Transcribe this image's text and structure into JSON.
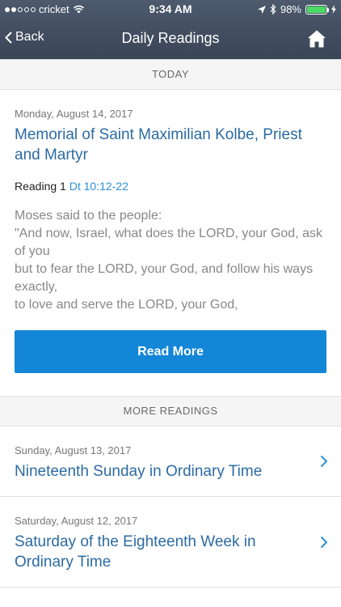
{
  "status_bar": {
    "carrier": "cricket",
    "time": "9:34 AM",
    "battery_percent": "98%",
    "battery_level": 0.98
  },
  "nav": {
    "back_label": "Back",
    "title": "Daily Readings",
    "home_icon": "home-icon"
  },
  "today": {
    "section_label": "TODAY",
    "date": "Monday, August 14, 2017",
    "title": "Memorial of Saint Maximilian Kolbe, Priest and Martyr",
    "reading_label": "Reading 1",
    "reading_ref": "Dt 10:12-22",
    "excerpt_lines": [
      "Moses said to the people:",
      "\"And now, Israel, what does the LORD, your God, ask of you",
      "but to fear the LORD, your God, and follow his ways exactly,",
      "to love and serve the LORD, your God,"
    ],
    "read_more_label": "Read More"
  },
  "more": {
    "section_label": "MORE READINGS",
    "items": [
      {
        "date": "Sunday, August 13, 2017",
        "title": "Nineteenth Sunday in Ordinary Time"
      },
      {
        "date": "Saturday, August 12, 2017",
        "title": "Saturday of the Eighteenth Week in Ordinary Time"
      }
    ]
  },
  "colors": {
    "header": "#3f4a5c",
    "accent": "#1486d7",
    "title_blue": "#2c6ba3"
  }
}
